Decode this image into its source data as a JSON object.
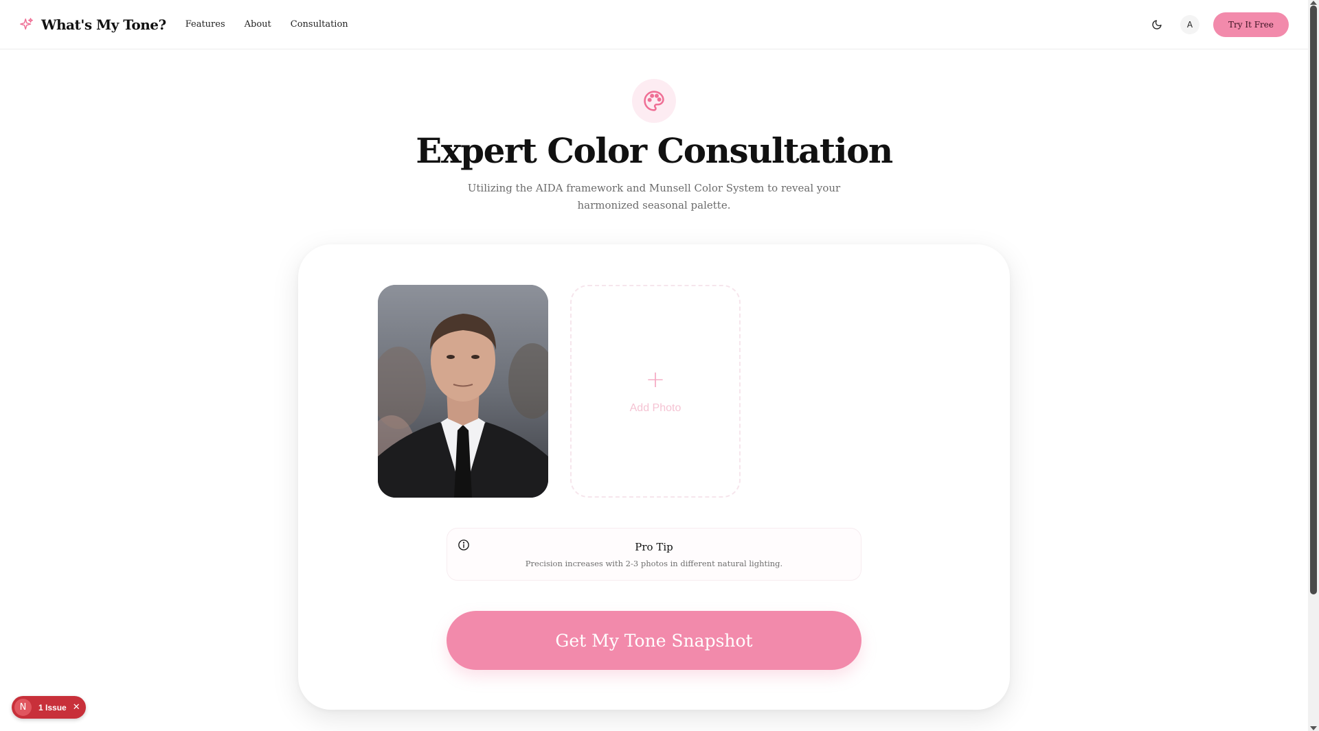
{
  "app": {
    "brand": "What's My Tone?",
    "accent_color": "#f28aab"
  },
  "nav": {
    "links": [
      {
        "label": "Features"
      },
      {
        "label": "About"
      },
      {
        "label": "Consultation"
      }
    ],
    "theme_toggle_icon": "moon-icon",
    "avatar_initial": "A",
    "try_label": "Try It Free"
  },
  "hero": {
    "icon": "palette-icon",
    "title": "Expert Color Consultation",
    "subtitle": "Utilizing the AIDA framework and Munsell Color System to reveal your harmonized seasonal palette."
  },
  "upload": {
    "add_photo_label": "Add Photo",
    "plus_glyph": "+"
  },
  "tip": {
    "title": "Pro Tip",
    "text": "Precision increases with 2-3 photos in different natural lighting."
  },
  "cta": {
    "label": "Get My Tone Snapshot"
  },
  "issue_badge": {
    "initial": "N",
    "label": "1 Issue",
    "close_glyph": "✕"
  }
}
